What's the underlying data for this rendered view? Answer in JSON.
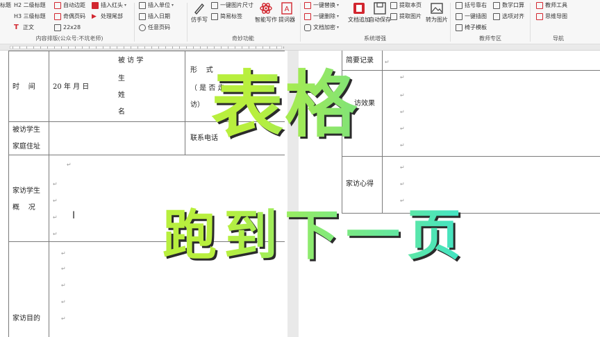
{
  "ribbon": {
    "groups": [
      {
        "label": "内容排版(公众号:不坑老师)",
        "items": [
          "标题",
          "H2 二级标题",
          "H3 三级标题",
          "正文",
          "自动边距",
          "奇偶页码",
          "22x28",
          "插入红头",
          "处理尾部"
        ]
      },
      {
        "label": "",
        "items": [
          "插入单位",
          "插入日期",
          "任意页码"
        ]
      },
      {
        "label": "奇妙功能",
        "items": [
          "仿手写",
          "一键图片尺寸",
          "简易标签",
          "智能写作",
          "提词器"
        ]
      },
      {
        "label": "系统增强",
        "items": [
          "一键替换",
          "一键删除",
          "文档加密",
          "文档追加",
          "自动保存",
          "提取本页",
          "提取图片",
          "转为图片"
        ]
      },
      {
        "label": "教师专区",
        "items": [
          "括号靠右",
          "数学口算",
          "一键插图",
          "选项对齐",
          "椅子模板"
        ]
      },
      {
        "label": "导航",
        "items": [
          "教师工具",
          "思维导图"
        ]
      }
    ]
  },
  "doc_left": {
    "row1": {
      "label": "时    间",
      "date": "20 年 月 日",
      "visited_label": [
        "被 访 学",
        "生",
        "姓",
        "名"
      ],
      "form_label": [
        "形    式",
        "（ 是 否 走",
        "访）"
      ]
    },
    "row2": {
      "label": [
        "被访学生",
        "家庭住址"
      ],
      "contact": "联系电话"
    },
    "row3": {
      "label": [
        "家访学生",
        "概    况"
      ]
    },
    "row4": {
      "label": "家访目的"
    }
  },
  "doc_right": {
    "record": "简要记录",
    "effect": "访效果",
    "feeling": "家访心得"
  },
  "marks": {
    "para": "↵",
    "cursor": "I"
  },
  "overlay": {
    "title": "表格",
    "subtitle": "跑到下一页"
  },
  "colors": {
    "overlay_green": "#b8ef3e",
    "overlay_cyan": "#3fe3c8",
    "accent_red": "#d2262f"
  }
}
